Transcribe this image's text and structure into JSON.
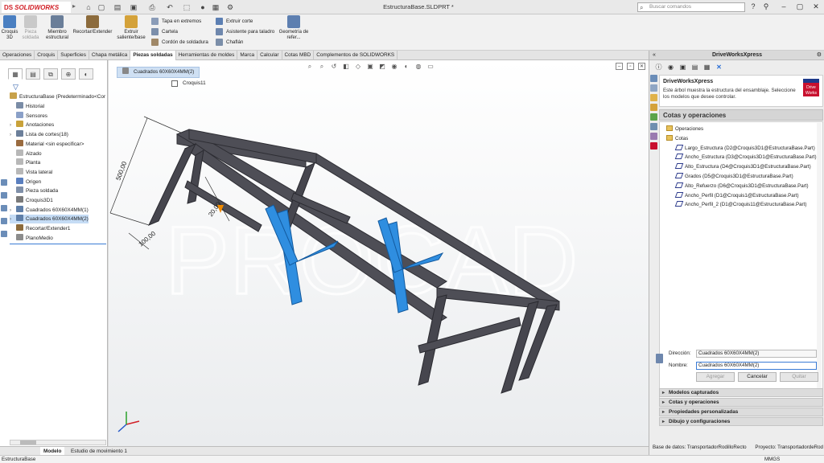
{
  "app": {
    "logo_brand": "DS",
    "logo_name": "SOLIDWORKS",
    "document_title": "EstructuraBase.SLDPRT *",
    "search_placeholder": "Buscar comandos"
  },
  "ribbon": {
    "big_buttons": [
      {
        "label": "Croquis 3D",
        "icon": "sketch3d-icon",
        "enabled": true
      },
      {
        "label": "Pieza soldada",
        "icon": "weldment-icon",
        "enabled": false
      },
      {
        "label": "Miembro estructural",
        "icon": "structural-member-icon",
        "enabled": true
      },
      {
        "label": "Recortar/Extender",
        "icon": "trim-extend-icon",
        "enabled": true
      },
      {
        "label": "Extruir saliente/base",
        "icon": "extrude-boss-icon",
        "enabled": true
      }
    ],
    "small_buttons_col1": [
      "Tapa en extremos",
      "Cartela",
      "Cordón de soldadura"
    ],
    "small_buttons_col2": [
      "Extruir corte",
      "Asistente para taladro",
      "Chaflán"
    ],
    "ref_geometry": "Geometría de refer..."
  },
  "tabs": [
    "Operaciones",
    "Croquis",
    "Superficies",
    "Chapa metálica",
    "Piezas soldadas",
    "Herramientas de moldes",
    "Marca",
    "Calcular",
    "Cotas MBD",
    "Complementos de SOLIDWORKS"
  ],
  "active_tab": "Piezas soldadas",
  "feature_tree": {
    "root": "EstructuraBase  (Predeterminado<Cor",
    "items": [
      {
        "label": "Historial",
        "expand": "",
        "icon_color": "#7a8ca6"
      },
      {
        "label": "Sensores",
        "expand": "",
        "icon_color": "#8aa0c8"
      },
      {
        "label": "Anotaciones",
        "expand": "›",
        "icon_color": "#c9a23a"
      },
      {
        "label": "Lista de cortes(18)",
        "expand": "›",
        "icon_color": "#6c7f9a"
      },
      {
        "label": "Material <sin especificar>",
        "expand": "",
        "icon_color": "#9a6b3f"
      },
      {
        "label": "Alzado",
        "expand": "",
        "icon_color": "#b8b8b8"
      },
      {
        "label": "Planta",
        "expand": "",
        "icon_color": "#b8b8b8"
      },
      {
        "label": "Vista lateral",
        "expand": "",
        "icon_color": "#b8b8b8"
      },
      {
        "label": "Origen",
        "expand": "",
        "icon_color": "#5a7fbf"
      },
      {
        "label": "Pieza soldada",
        "expand": "",
        "icon_color": "#7f8fa8"
      },
      {
        "label": "Croquis3D1",
        "expand": "",
        "icon_color": "#7a7a7a"
      },
      {
        "label": "Cuadrados 60X60X4MM(1)",
        "expand": "›",
        "icon_color": "#5f7fa8"
      },
      {
        "label": "Cuadrados 60X60X4MM(2)",
        "expand": "›",
        "icon_color": "#5f7fa8",
        "selected": true
      },
      {
        "label": "Recortar/Extender1",
        "expand": "",
        "icon_color": "#8c6b3c"
      },
      {
        "label": "PlanoMedio",
        "expand": "",
        "icon_color": "#8c8c8c"
      }
    ]
  },
  "viewport": {
    "breadcrumb": "Cuadrados 60X60X4MM(2)",
    "sketch_label": "Croquis11",
    "dimensions": [
      "500,00",
      "20,00",
      "100,00"
    ],
    "watermark": "PROCAD"
  },
  "bottom_tabs": [
    "Modelo",
    "Estudio de movimiento 1"
  ],
  "status_left": "EstructuraBase",
  "status_right": "MMGS",
  "driveworks": {
    "panel_title": "DriveWorksXpress",
    "info_title": "DriveWorksXpress",
    "info_desc": "Este árbol muestra la estructura del ensamblaje. Seleccione los modelos que desee controlar.",
    "logo_text": "Drive Works",
    "section_title": "Cotas y operaciones",
    "tree": [
      {
        "label": "Operaciones",
        "type": "folder",
        "level": 1
      },
      {
        "label": "Cotas",
        "type": "folder",
        "level": 1
      },
      {
        "label": "Largo_Estructura (D2@Croquis3D1@EstructuraBase.Part)",
        "type": "dim",
        "level": 2
      },
      {
        "label": "Ancho_Estructura (D3@Croquis3D1@EstructuraBase.Part)",
        "type": "dim",
        "level": 2
      },
      {
        "label": "Alto_Estructura (D4@Croquis3D1@EstructuraBase.Part)",
        "type": "dim",
        "level": 2
      },
      {
        "label": "Grados (D5@Croquis3D1@EstructuraBase.Part)",
        "type": "dim",
        "level": 2
      },
      {
        "label": "Alto_Refuerzo (D6@Croquis3D1@EstructuraBase.Part)",
        "type": "dim",
        "level": 2
      },
      {
        "label": "Ancho_Perfil (D1@Croquis1@EstructuraBase.Part)",
        "type": "dim",
        "level": 2
      },
      {
        "label": "Ancho_Perfil_2 (D1@Croquis11@EstructuraBase.Part)",
        "type": "dim",
        "level": 2
      }
    ],
    "form": {
      "direccion_label": "Dirección:",
      "direccion_value": "Cuadrados 60X60X4MM(2)",
      "nombre_label": "Nombre:",
      "nombre_value": "Cuadrados 60X60X4MM(2)"
    },
    "buttons": [
      {
        "label": "Agregar",
        "enabled": false
      },
      {
        "label": "Cancelar",
        "enabled": true
      },
      {
        "label": "Quitar",
        "enabled": false
      }
    ],
    "accordion": [
      "Modelos capturados",
      "Cotas y operaciones",
      "Propiedades personalizadas",
      "Dibujo y configuraciones"
    ],
    "footer_db": "Base de datos: TransportadorRodilloRecto",
    "footer_project": "Proyecto: TransportadordeRod"
  },
  "colors": {
    "accent": "#3a7bd5",
    "selection": "#c5dcf5",
    "frame": "#4a4a52",
    "highlight": "#1f8ad8"
  }
}
